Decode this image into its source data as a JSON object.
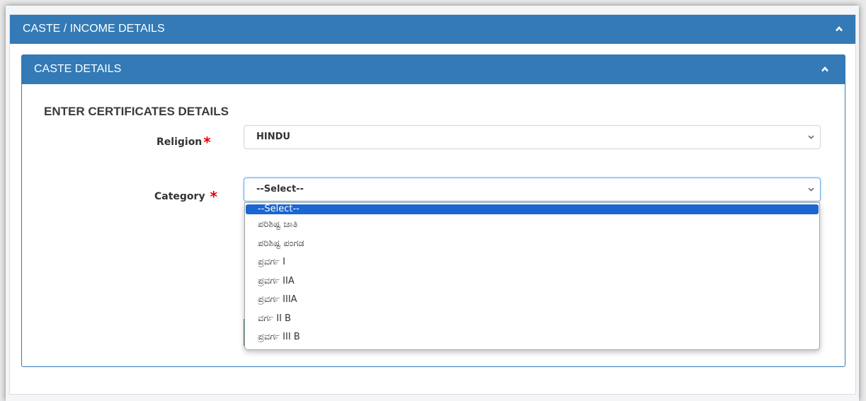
{
  "outer_panel": {
    "title": "CASTE / INCOME DETAILS"
  },
  "inner_panel": {
    "title": "CASTE DETAILS"
  },
  "section_title": "ENTER CERTIFICATES DETAILS",
  "religion": {
    "label": "Religion",
    "required_mark": "*",
    "value": "HINDU"
  },
  "category": {
    "label": "Category",
    "required_mark": "*",
    "value": "--Select--"
  },
  "dropdown": {
    "options": [
      "--Select--",
      "ಪರಿಶಿಷ್ಟ ಜಾತಿ",
      "ಪರಿಶಿಷ್ಟ ಪಂಗಡ",
      "ಪ್ರವರ್ಗ I",
      "ಪ್ರವರ್ಗ IIA",
      "ಪ್ರವರ್ಗ IIIA",
      "ವರ್ಗ II B",
      "ಪ್ರವರ್ಗ III B"
    ],
    "selected_index": 0
  },
  "colors": {
    "panel_header": "#337ab7",
    "selected_option": "#1a66d2",
    "required": "#e60000"
  },
  "icons": {
    "outer_collapse": "chevron-up-icon",
    "inner_collapse": "chevron-up-icon",
    "select_arrow": "chevron-down-icon"
  }
}
